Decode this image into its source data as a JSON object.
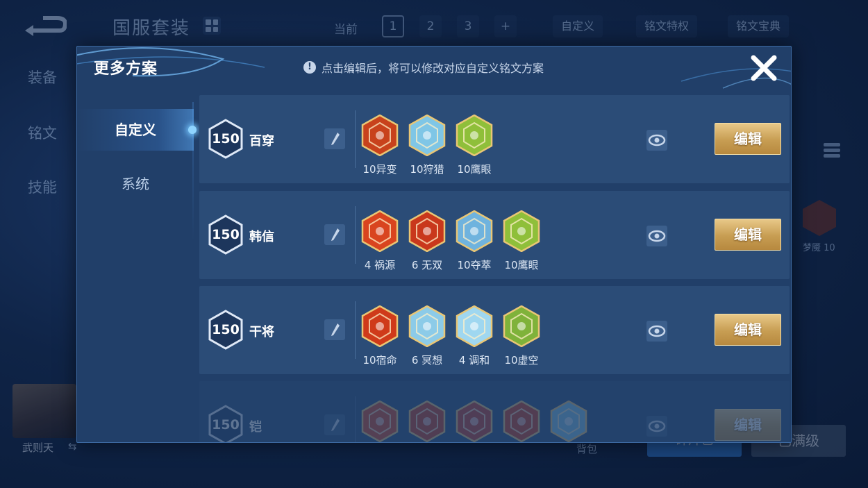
{
  "background": {
    "title": "国服套装",
    "current_label": "当前",
    "page_tabs": [
      "1",
      "2",
      "3",
      "+"
    ],
    "custom_chip": "自定义",
    "rune_privilege": "铭文特权",
    "rune_guide": "铭文宝典",
    "side_tabs": [
      "装备",
      "铭文",
      "技能"
    ],
    "side_rune_label": "梦魇 10",
    "hero_name": "武则天",
    "bag_label": "背包",
    "blue_button": "碎片包",
    "max_button": "已满级"
  },
  "modal": {
    "title": "更多方案",
    "hint": "点击编辑后，将可以修改对应自定义铭文方案",
    "tabs": [
      {
        "label": "自定义",
        "active": true
      },
      {
        "label": "系统",
        "active": false
      }
    ],
    "edit_label": "编辑",
    "schemes": [
      {
        "level": "150",
        "name": "百穿",
        "runes": [
          {
            "label": "10异变",
            "color": "#c8421c",
            "icon": "mutation-rune-icon"
          },
          {
            "label": "10狩猎",
            "color": "#7fc6e6",
            "icon": "hunt-rune-icon"
          },
          {
            "label": "10鹰眼",
            "color": "#8fbf3a",
            "icon": "hawkeye-rune-icon"
          }
        ]
      },
      {
        "level": "150",
        "name": "韩信",
        "runes": [
          {
            "label": "4 祸源",
            "color": "#d9441f",
            "icon": "calamity-rune-icon"
          },
          {
            "label": "6 无双",
            "color": "#c9381c",
            "icon": "peerless-rune-icon"
          },
          {
            "label": "10夺萃",
            "color": "#6fb3de",
            "icon": "plunder-rune-icon"
          },
          {
            "label": "10鹰眼",
            "color": "#8fbf3a",
            "icon": "hawkeye-rune-icon"
          }
        ]
      },
      {
        "level": "150",
        "name": "干将",
        "runes": [
          {
            "label": "10宿命",
            "color": "#cf3a1a",
            "icon": "fate-rune-icon"
          },
          {
            "label": "6 冥想",
            "color": "#8ccbe8",
            "icon": "meditation-rune-icon"
          },
          {
            "label": "4 调和",
            "color": "#9fd7f0",
            "icon": "harmony-rune-icon"
          },
          {
            "label": "10虚空",
            "color": "#7fb23a",
            "icon": "void-rune-icon"
          }
        ]
      },
      {
        "level": "150",
        "name": "铠",
        "runes": [
          {
            "label": "",
            "color": "#d9441f",
            "icon": "rune-icon"
          },
          {
            "label": "",
            "color": "#c9381c",
            "icon": "rune-icon"
          },
          {
            "label": "",
            "color": "#c73a26",
            "icon": "rune-icon"
          },
          {
            "label": "",
            "color": "#cf3a1a",
            "icon": "rune-icon"
          },
          {
            "label": "",
            "color": "#7fc6e6",
            "icon": "rune-icon"
          }
        ]
      }
    ]
  }
}
